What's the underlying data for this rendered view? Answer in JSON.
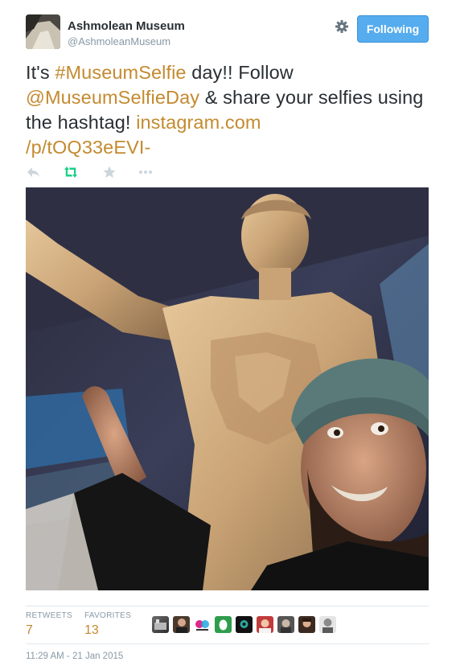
{
  "account": {
    "name": "Ashmolean Museum",
    "handle": "@AshmoleanMuseum",
    "follow_button": "Following"
  },
  "tweet": {
    "text_1": "It's ",
    "hashtag": "#MuseumSelfie",
    "text_2": " day!! Follow ",
    "mention": "@MuseumSelfieDay",
    "text_3": " & share your selfies using the hashtag! ",
    "link_part1": "instagram.com",
    "link_part2": "/p/tOQ33eEVI-"
  },
  "actions": {
    "icons": [
      "reply-icon",
      "retweet-icon",
      "favorite-icon",
      "more-icon"
    ],
    "retweet_color": "#19cf86",
    "default_color": "#ccd6dd"
  },
  "stats": {
    "retweets_label": "RETWEETS",
    "retweets_value": "7",
    "favorites_label": "FAVORITES",
    "favorites_value": "13"
  },
  "favoriters_count_shown": 9,
  "timestamp": "11:29 AM - 21 Jan 2015",
  "colors": {
    "link": "#c48a2f",
    "follow_button": "#55acee",
    "muted": "#8899a6"
  }
}
